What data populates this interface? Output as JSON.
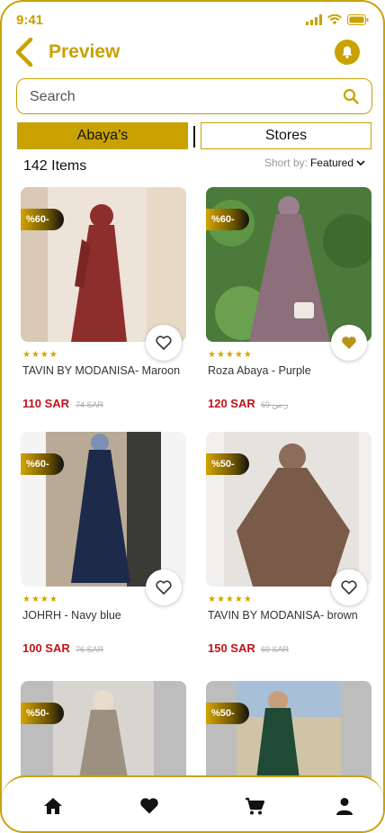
{
  "status_bar": {
    "time": "9:41"
  },
  "header": {
    "title": "Preview"
  },
  "search": {
    "placeholder": "Search"
  },
  "tabs": [
    {
      "label": "Abaya’s",
      "active": true
    },
    {
      "label": "Stores",
      "active": false
    }
  ],
  "listing": {
    "count": "142 Items",
    "sort_label": "Short by:",
    "sort_value": "Featured"
  },
  "products": [
    {
      "name": "TAVIN BY MODANISA- Maroon",
      "price": "110 SAR",
      "old_price": "74 SAR",
      "discount": "%60-",
      "rating_stars": "★★★★",
      "favorite": false
    },
    {
      "name": "Roza Abaya - Purple",
      "price": "120 SAR",
      "old_price": "69 ر.س",
      "discount": "%60-",
      "rating_stars": "★★★★★",
      "favorite": true
    },
    {
      "name": "JOHRH - Navy blue",
      "price": "100 SAR",
      "old_price": "76 SAR",
      "discount": "%60-",
      "rating_stars": "★★★★",
      "favorite": false
    },
    {
      "name": "TAVIN BY MODANISA- brown",
      "price": "150 SAR",
      "old_price": "69 SAR",
      "discount": "%50-",
      "rating_stars": "★★★★★",
      "favorite": false
    },
    {
      "discount": "%50-"
    },
    {
      "discount": "%50-"
    }
  ],
  "colors": {
    "accent": "#c9a200",
    "price": "#c0141a"
  },
  "bottom_nav": [
    "home-icon",
    "heart-icon",
    "cart-icon",
    "profile-icon"
  ]
}
